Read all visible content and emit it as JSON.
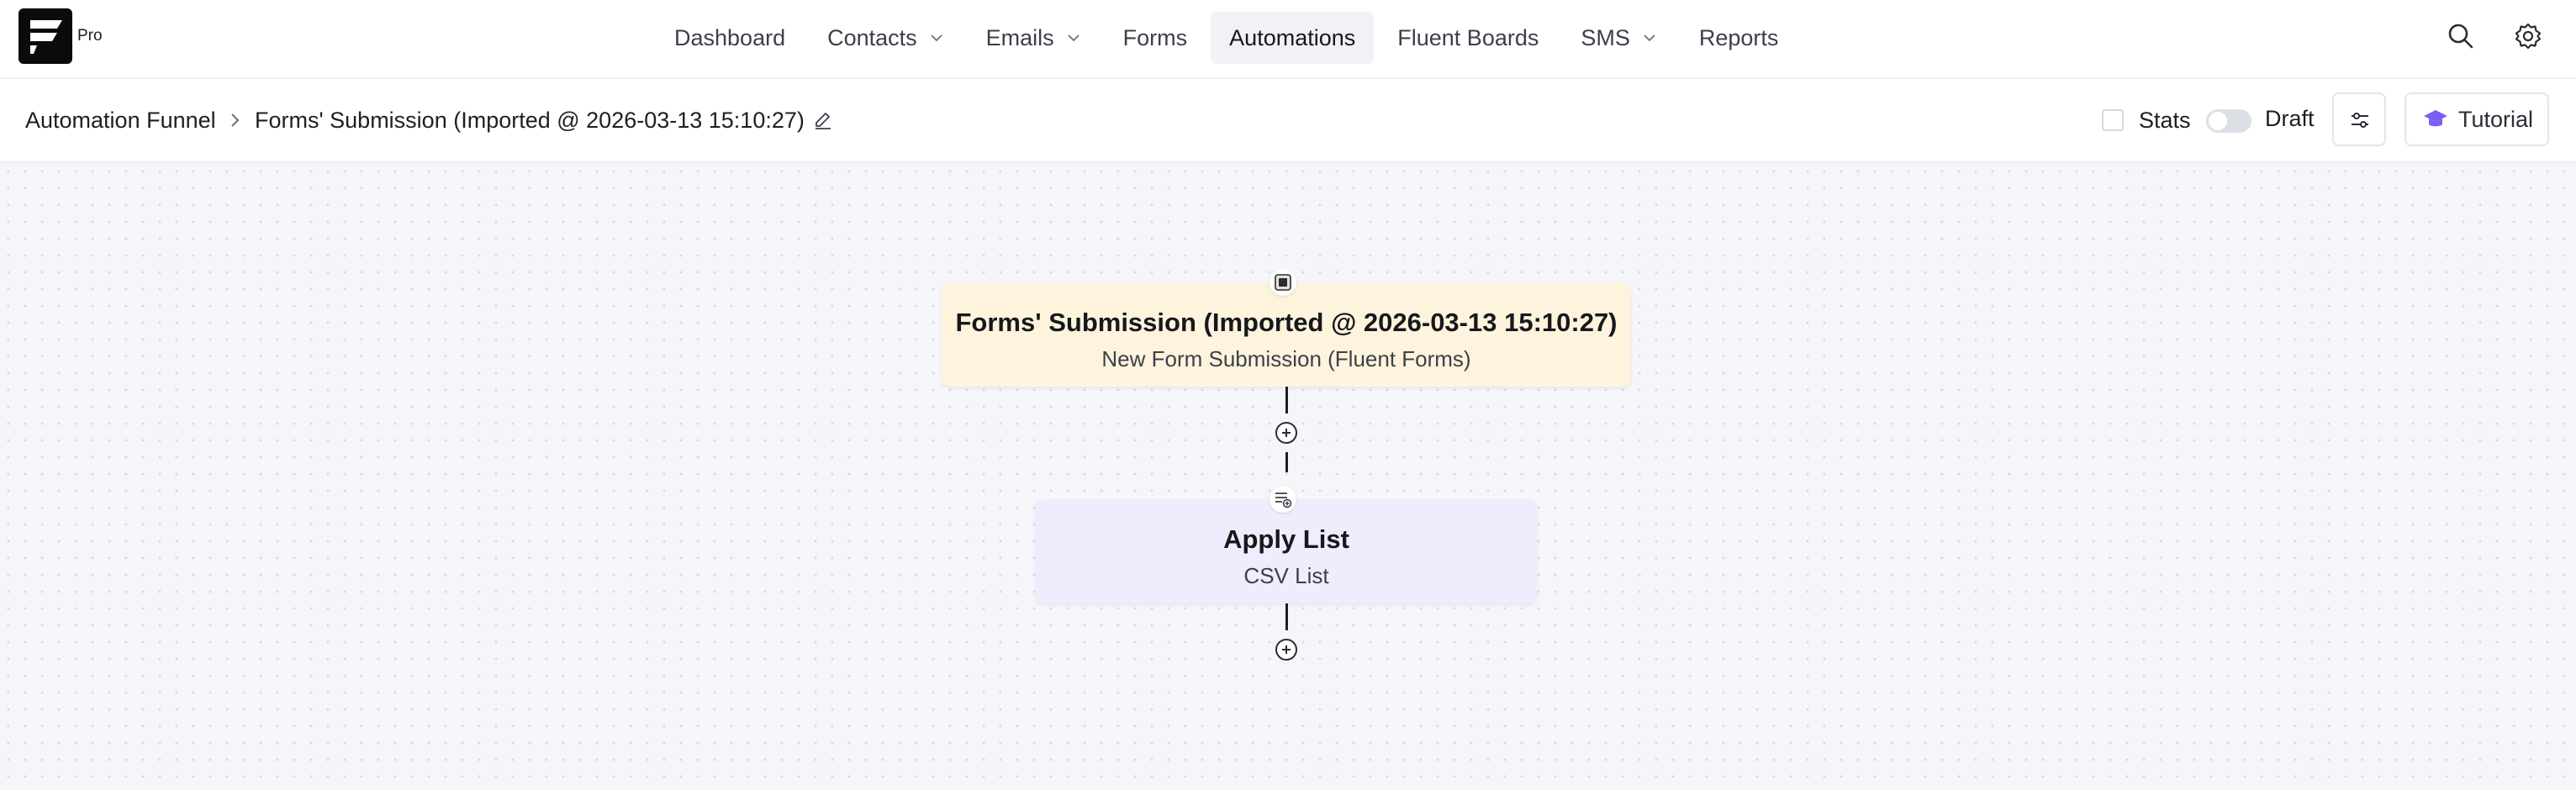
{
  "header": {
    "logo_badge": "Pro",
    "nav": [
      {
        "label": "Dashboard",
        "has_dropdown": false
      },
      {
        "label": "Contacts",
        "has_dropdown": true
      },
      {
        "label": "Emails",
        "has_dropdown": true
      },
      {
        "label": "Forms",
        "has_dropdown": false
      },
      {
        "label": "Automations",
        "has_dropdown": false,
        "active": true
      },
      {
        "label": "Fluent Boards",
        "has_dropdown": false
      },
      {
        "label": "SMS",
        "has_dropdown": true
      },
      {
        "label": "Reports",
        "has_dropdown": false
      }
    ],
    "icons": {
      "search": "search-icon",
      "settings": "gear-icon"
    }
  },
  "subheader": {
    "breadcrumb_root": "Automation Funnel",
    "funnel_title": "Forms' Submission (Imported @ 2026-03-13 15:10:27)",
    "stats_label": "Stats",
    "stats_checked": false,
    "status_toggle_on": false,
    "status_label": "Draft",
    "tutorial_label": "Tutorial"
  },
  "workflow": {
    "trigger": {
      "title": "Forms' Submission (Imported @ 2026-03-13 15:10:27)",
      "subtitle": "New Form Submission (Fluent Forms)",
      "icon": "form-icon"
    },
    "action": {
      "title": "Apply List",
      "subtitle": "CSV List",
      "icon": "list-add-icon"
    }
  },
  "colors": {
    "accent": "#7c5cf5",
    "trigger_bg": "#fef4dd",
    "action_bg": "#f0ecfd",
    "canvas_bg": "#f5f6fa"
  }
}
